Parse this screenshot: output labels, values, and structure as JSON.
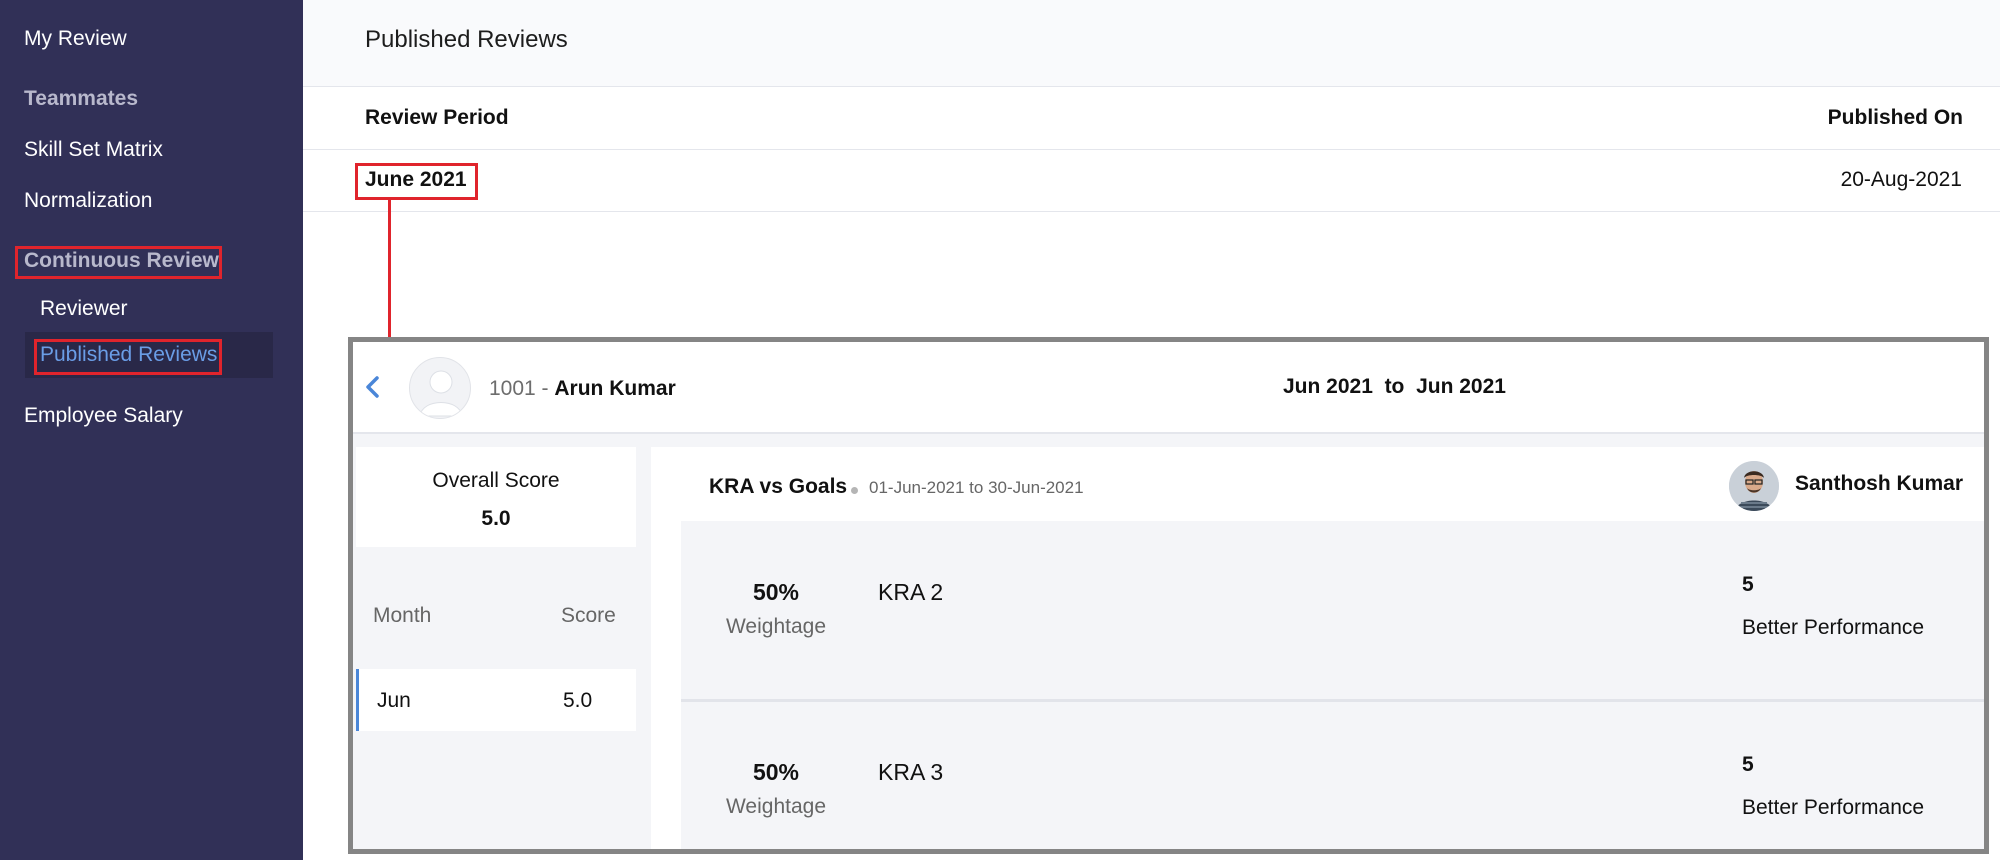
{
  "sidebar": {
    "items": [
      {
        "label": "My Review"
      },
      {
        "label": "Teammates"
      },
      {
        "label": "Skill Set Matrix"
      },
      {
        "label": "Normalization"
      },
      {
        "label": "Continuous Review"
      },
      {
        "label": "Reviewer"
      },
      {
        "label": "Published Reviews"
      },
      {
        "label": "Employee Salary"
      }
    ],
    "active_color": "#6a9de6",
    "background": "#313057"
  },
  "header": {
    "title": "Published Reviews"
  },
  "table": {
    "columns": [
      "Review Period",
      "Published On"
    ],
    "rows": [
      {
        "period": "June 2021",
        "published_on": "20-Aug-2021"
      }
    ]
  },
  "detail": {
    "employee_id": "1001 - ",
    "employee_name": "Arun Kumar",
    "period_from": "Jun 2021",
    "period_sep": "to",
    "period_to": "Jun 2021",
    "overall_label": "Overall Score",
    "overall_value": "5.0",
    "month_col": "Month",
    "score_col": "Score",
    "months": [
      {
        "month": "Jun",
        "score": "5.0"
      }
    ],
    "kra_title": "KRA vs Goals",
    "kra_dates": "01-Jun-2021 to 30-Jun-2021",
    "reviewer": "Santhosh Kumar",
    "kras": [
      {
        "weight": "50%",
        "weight_label": "Weightage",
        "name": "KRA 2",
        "score": "5",
        "rating": "Better Performance"
      },
      {
        "weight": "50%",
        "weight_label": "Weightage",
        "name": "KRA 3",
        "score": "5",
        "rating": "Better Performance"
      }
    ]
  },
  "highlight_color": "#e0242c",
  "icons": {
    "back": "chevron-left-icon",
    "avatar": "user-avatar-icon",
    "reviewer": "reviewer-photo-icon"
  }
}
